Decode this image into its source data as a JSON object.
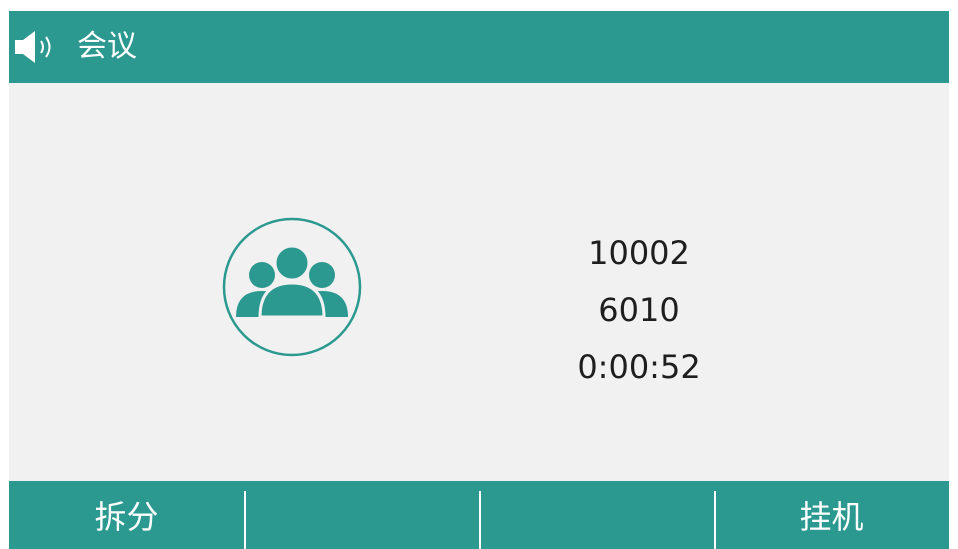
{
  "colors": {
    "accent": "#2b9990",
    "background": "#f1f1f1",
    "text": "#1e1e1e"
  },
  "header": {
    "icon": "speaker-volume-icon",
    "title": "会议"
  },
  "call": {
    "avatar_icon": "conference-group-icon",
    "lines": [
      "10002",
      "6010",
      "0:00:52"
    ]
  },
  "softkeys": [
    {
      "label": "拆分"
    },
    {
      "label": ""
    },
    {
      "label": ""
    },
    {
      "label": "挂机"
    }
  ]
}
